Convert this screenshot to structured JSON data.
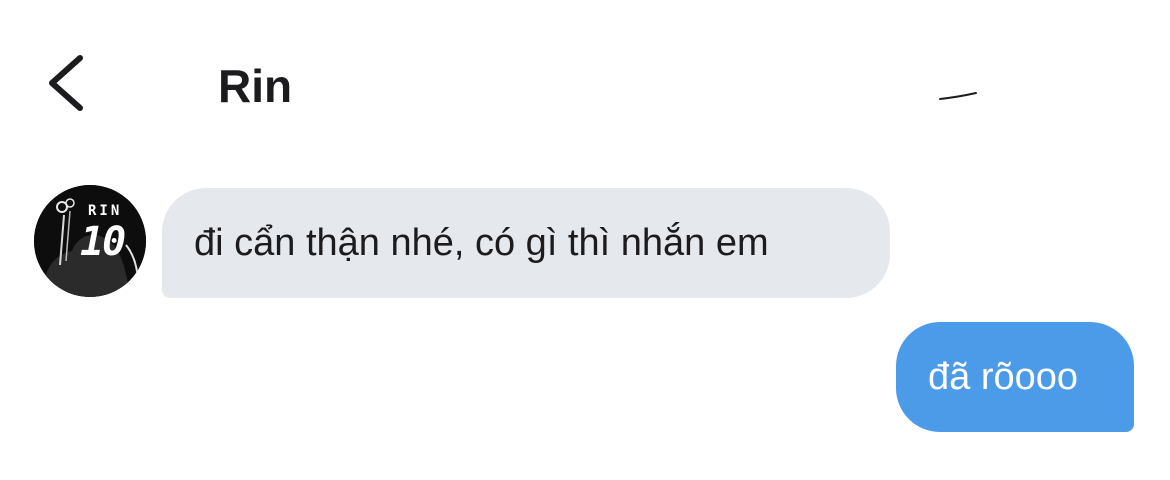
{
  "header": {
    "back_icon": "chevron-left-icon",
    "contact_name": "Rin"
  },
  "conversation": {
    "avatar": {
      "icon": "avatar-image",
      "text_small": "RIN",
      "text_number": "10"
    },
    "messages": [
      {
        "direction": "incoming",
        "text": "đi cẩn thận nhé, có gì thì nhắn em"
      },
      {
        "direction": "outgoing",
        "text": "đã rõooo"
      }
    ]
  },
  "colors": {
    "incoming_bubble": "#e5e8ed",
    "outgoing_bubble": "#4c9be8",
    "text_dark": "#1c1c1e",
    "text_light": "#ffffff",
    "background": "#ffffff"
  }
}
